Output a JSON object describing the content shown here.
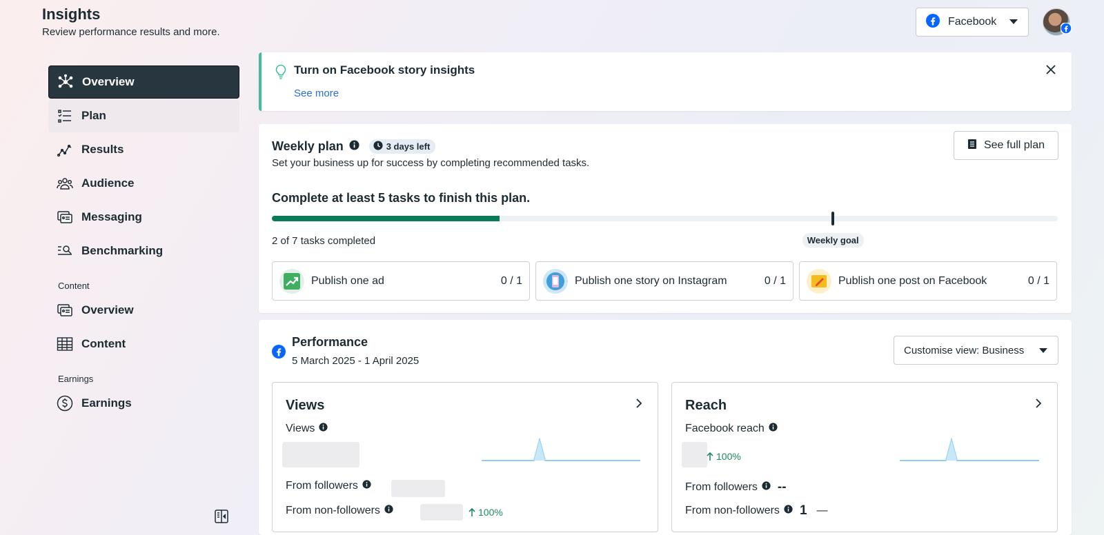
{
  "header": {
    "title": "Insights",
    "subtitle": "Review performance results and more.",
    "platform_label": "Facebook"
  },
  "sidebar": {
    "items": [
      {
        "label": "Overview",
        "icon": "overview-icon"
      },
      {
        "label": "Plan",
        "icon": "plan-icon"
      },
      {
        "label": "Results",
        "icon": "results-icon"
      },
      {
        "label": "Audience",
        "icon": "audience-icon"
      },
      {
        "label": "Messaging",
        "icon": "messaging-icon"
      },
      {
        "label": "Benchmarking",
        "icon": "benchmarking-icon"
      }
    ],
    "content_section": "Content",
    "content_items": [
      {
        "label": "Overview",
        "icon": "content-overview-icon"
      },
      {
        "label": "Content",
        "icon": "table-icon"
      }
    ],
    "earnings_section": "Earnings",
    "earnings_items": [
      {
        "label": "Earnings",
        "icon": "dollar-icon"
      }
    ]
  },
  "banner": {
    "title": "Turn on Facebook story insights",
    "link": "See more"
  },
  "weekly_plan": {
    "title": "Weekly plan",
    "days_left": "3 days left",
    "subtitle": "Set your business up for success by completing recommended tasks.",
    "see_full_plan": "See full plan",
    "goal_text": "Complete at least 5 tasks to finish this plan.",
    "completed_text": "2 of 7 tasks completed",
    "progress": 0.29,
    "goal_fraction": 0.714,
    "goal_label": "Weekly goal",
    "tasks": [
      {
        "label": "Publish one ad",
        "count": "0 / 1"
      },
      {
        "label": "Publish one story on Instagram",
        "count": "0 / 1"
      },
      {
        "label": "Publish one post on Facebook",
        "count": "0 / 1"
      }
    ]
  },
  "performance": {
    "title": "Performance",
    "date_range": "5 March 2025 - 1 April 2025",
    "customise_view": "Customise view: Business",
    "views": {
      "title": "Views",
      "metric_label": "Views",
      "from_followers": "From followers",
      "from_non_followers": "From non-followers",
      "non_followers_change": "100%"
    },
    "reach": {
      "title": "Reach",
      "metric_label": "Facebook reach",
      "reach_change": "100%",
      "from_followers": "From followers",
      "from_followers_value": "--",
      "from_non_followers": "From non-followers",
      "from_non_followers_value": "1",
      "from_non_followers_change": "—"
    }
  },
  "colors": {
    "accent_green": "#0a7a5a",
    "banner_border": "#3ebd9a",
    "link_blue": "#2b70c9",
    "facebook_blue": "#0866ff",
    "sidebar_active_bg": "#283640"
  }
}
